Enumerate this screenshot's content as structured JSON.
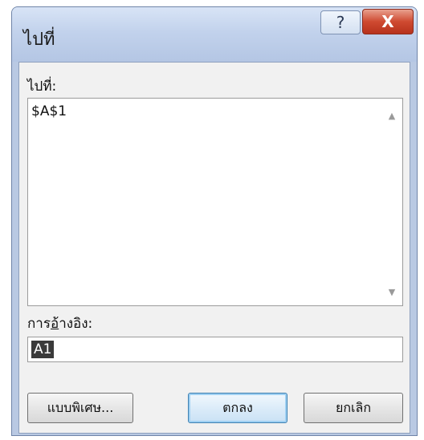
{
  "window": {
    "title": "ไปที่",
    "help_label": "?",
    "close_label": "X"
  },
  "goto": {
    "label": "ไปที่:",
    "items": [
      "$A$1"
    ]
  },
  "reference": {
    "label_before": "การ",
    "label_underlined": "อ้",
    "label_after": "างอิง:",
    "value": "A1"
  },
  "buttons": {
    "special_label": "แบบพิเศษ...",
    "ok_label": "ตกลง",
    "cancel_label": "ยกเลิก"
  },
  "icons": {
    "scroll_up": "scroll-up-arrow-icon",
    "scroll_down": "scroll-down-arrow-icon"
  }
}
